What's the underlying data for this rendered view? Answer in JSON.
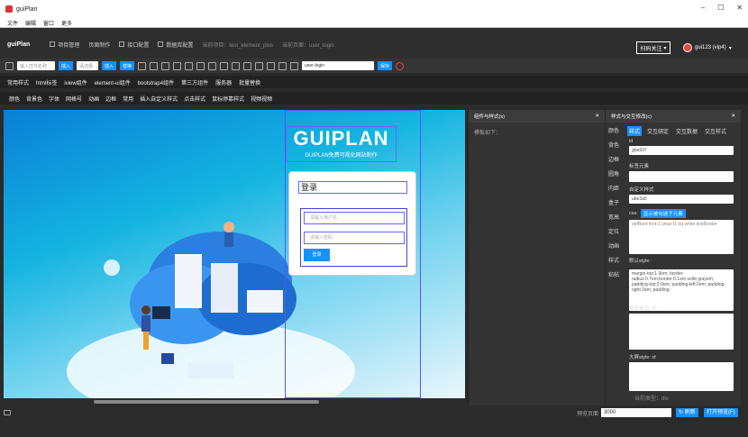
{
  "window": {
    "title": "guiPlan",
    "min": "–",
    "max": "☐",
    "close": "✕"
  },
  "menu": [
    "文件",
    "编辑",
    "窗口",
    "更多"
  ],
  "appbar": {
    "brand": "guiPlan",
    "nav": [
      "项目管理",
      "页面制作",
      "接口配置",
      "数据库配置"
    ],
    "current_project": "当前项目：test_element_plus",
    "current_page": "当前页面：user_login",
    "focus_label": "扫码关注",
    "user": "gui123 (vip4)"
  },
  "toolbar": {
    "search_placeholder": "输入控件名称",
    "insert": "插入",
    "select_placeholder": "请选择",
    "insert2": "插入",
    "replace": "替换",
    "page_value": "user-login",
    "save": "保存"
  },
  "categories1": [
    "常用样式",
    "html标签",
    "iview组件",
    "element-ui组件",
    "bootstrap4组件",
    "第三方组件",
    "服务器",
    "批量替换"
  ],
  "categories2": [
    "颜色",
    "背景色",
    "字体",
    "网格号",
    "动画",
    "边框",
    "常用",
    "插入自定义样式",
    "点击样式",
    "鼠标停靠样式",
    "视频视频"
  ],
  "canvas": {
    "logo_text": "GUIPLAN",
    "logo_sub": "GUIPLAN免费可视化网站制作",
    "login_title": "登录",
    "user_placeholder": "请输入用户名",
    "pass_placeholder": "请输入密码",
    "login_button": "登录"
  },
  "panel_a": {
    "title": "组件与样式(x)",
    "close": "✕",
    "hint": "模板如下："
  },
  "panel_b": {
    "title": "样式与交互修改(c)",
    "close": "✕",
    "sidetabs": [
      "颜色",
      "背色",
      "边框",
      "圆角",
      "内距",
      "盒子",
      "宽高",
      "定位",
      "动画",
      "样式",
      "粘帖"
    ],
    "tabs": [
      "样式",
      "交互绑定",
      "交互数据",
      "交互样式"
    ],
    "id_label": "id",
    "id_value": "gba937",
    "tag_label": "标签元素",
    "custom_label": "自定义样式",
    "custom_value": "ube3a5",
    "css_label": "css:",
    "css_button": "显示被勾选子元素",
    "css_value": "defBord font-1 umar-l1 bg-white testBorder",
    "default_label": "默认style:",
    "default_value": "margin-top:1.9em; border-radius:0.7em;border:0.1em solid grayem; padding-top:2.0em; padding-left:2em; padding-right:2em; padding-",
    "hover_label": "停靠样式:",
    "screen_label": "大屏style: sf",
    "footer_note": "当前类型：div"
  },
  "footer": {
    "preview_label": "预览页面",
    "preview_value": "3000",
    "refresh": "刷新",
    "open_preview": "打开预览(F)"
  }
}
